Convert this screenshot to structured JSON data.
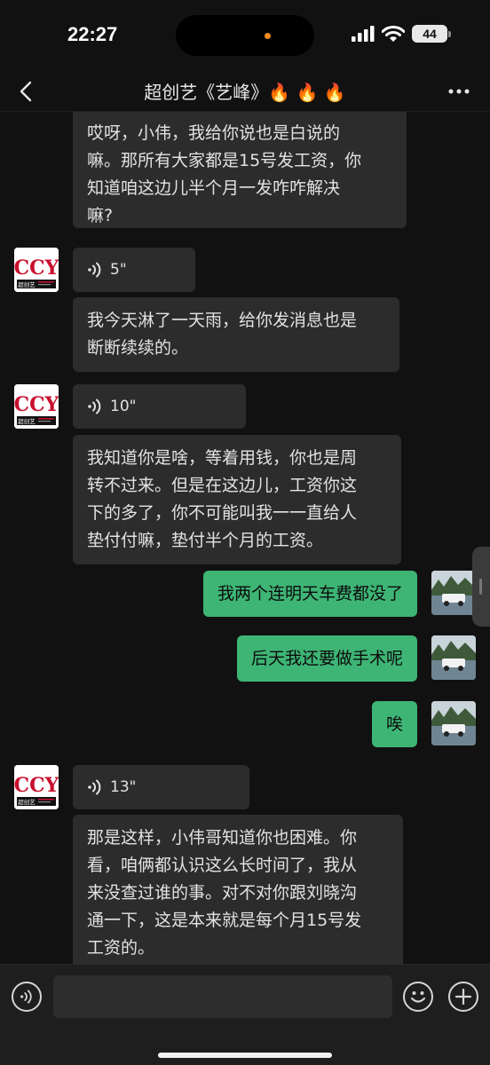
{
  "status_bar": {
    "time": "22:27",
    "battery": "44"
  },
  "chat_header": {
    "title": "超创艺《艺峰》🔥 🔥  🔥"
  },
  "messages": [
    {
      "type": "text",
      "lines": [
        "哎呀，小伟，我给你说也是白说的",
        "嘛。那所有大家都是15号发工资，你",
        "知道咱这边儿半个月一发咋咋解决",
        "嘛?"
      ]
    },
    {
      "type": "voice",
      "duration": "5\""
    },
    {
      "type": "text",
      "lines": [
        "我今天淋了一天雨，给你发消息也是",
        "断断续续的。"
      ]
    },
    {
      "type": "voice",
      "duration": "10\""
    },
    {
      "type": "text",
      "lines": [
        "我知道你是啥，等着用钱，你也是周",
        "转不过来。但是在这边儿，工资你这",
        "下的多了，你不可能叫我一一直给人",
        "垫付付嘛，垫付半个月的工资。"
      ]
    },
    {
      "type": "outgoing",
      "text": "我两个连明天车费都没了"
    },
    {
      "type": "outgoing",
      "text": "后天我还要做手术呢"
    },
    {
      "type": "outgoing",
      "text": "唉"
    },
    {
      "type": "voice",
      "duration": "13\""
    },
    {
      "type": "text",
      "lines": [
        "那是这样，小伟哥知道你也困难。你",
        "看，咱俩都认识这么长时间了，我从",
        "来没查过谁的事。对不对你跟刘晓沟",
        "通一下，这是本来就是每个月15号发",
        "工资的。"
      ]
    }
  ],
  "avatar_logo": {
    "text": "CCY",
    "subtext": "超创艺"
  },
  "colors": {
    "background": "#111111",
    "incoming_bubble": "#2c2c2c",
    "outgoing_bubble": "#3eb575",
    "logo_red": "#c8102e"
  }
}
